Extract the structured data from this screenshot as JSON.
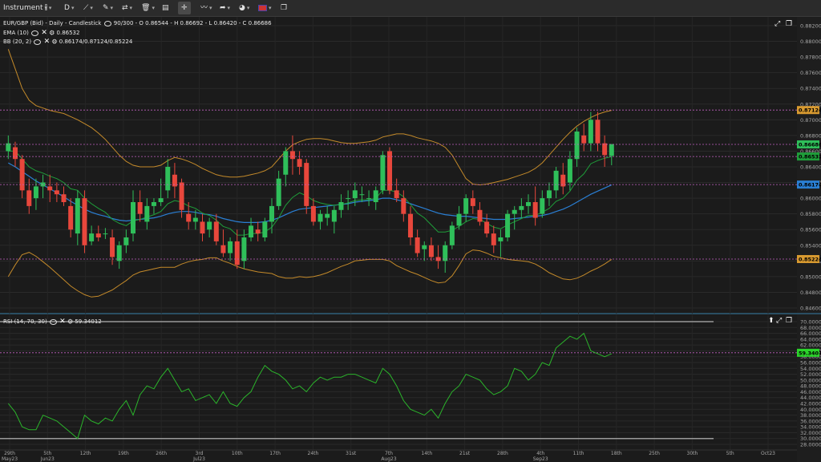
{
  "toolbar": {
    "instrument": "Instrument",
    "timeframe": "D"
  },
  "legend": {
    "main": "EUR/GBP (Bid) - Daily - Candlestick",
    "main_count": "90/300",
    "main_ohlc": "- O 0.86544 - H 0.86692 - L 0.86420 - C 0.86686",
    "ema_label": "EMA (10)",
    "ema_value": "0.86532",
    "bb_label": "BB (20, 2)",
    "bb_value": "0.86174/0.87124/0.85224",
    "rsi_label": "RSI (14, 70, 30)",
    "rsi_value": "59.34012"
  },
  "colors": {
    "up": "#2fbf5a",
    "down": "#e8473c",
    "ema": "#1f9e3a",
    "bb_mid": "#2a7fd4",
    "bb_band": "#c48a2a",
    "rsi": "#2bb52b",
    "hline": "#c060c0"
  },
  "price_axis": {
    "labels": [
      "0.88200",
      "0.88000",
      "0.87800",
      "0.87600",
      "0.87400",
      "0.87200",
      "0.87000",
      "0.86800",
      "0.86600",
      "0.86400",
      "0.86200",
      "0.86000",
      "0.85800",
      "0.85600",
      "0.85400",
      "0.85200",
      "0.85000",
      "0.84800",
      "0.84600"
    ],
    "markers": [
      {
        "value": 0.87124,
        "label": "0.87124",
        "color": "#d89a30"
      },
      {
        "value": 0.86686,
        "label": "0.86686",
        "color": "#2fbf5a"
      },
      {
        "value": 0.86532,
        "label": "0.86532",
        "color": "#1f9e3a"
      },
      {
        "value": 0.86174,
        "label": "0.86174",
        "color": "#2a7fd4"
      },
      {
        "value": 0.85224,
        "label": "0.85224",
        "color": "#d89a30"
      }
    ]
  },
  "rsi_axis": {
    "labels": [
      "70.00000",
      "68.00000",
      "66.00000",
      "64.00000",
      "62.00000",
      "60.00000",
      "58.00000",
      "56.00000",
      "54.00000",
      "52.00000",
      "50.00000",
      "48.00000",
      "46.00000",
      "44.00000",
      "42.00000",
      "40.00000",
      "38.00000",
      "36.00000",
      "34.00000",
      "32.00000",
      "30.00000",
      "28.00000"
    ],
    "marker": {
      "value": 59.34,
      "label": "59.34012"
    }
  },
  "x_axis": [
    {
      "day": "29th",
      "sub": "May23"
    },
    {
      "day": "5th",
      "sub": "Jun23"
    },
    {
      "day": "12th",
      "sub": ""
    },
    {
      "day": "19th",
      "sub": ""
    },
    {
      "day": "26th",
      "sub": ""
    },
    {
      "day": "3rd",
      "sub": "Jul23"
    },
    {
      "day": "10th",
      "sub": ""
    },
    {
      "day": "17th",
      "sub": ""
    },
    {
      "day": "24th",
      "sub": ""
    },
    {
      "day": "31st",
      "sub": ""
    },
    {
      "day": "7th",
      "sub": "Aug23"
    },
    {
      "day": "14th",
      "sub": ""
    },
    {
      "day": "21st",
      "sub": ""
    },
    {
      "day": "28th",
      "sub": ""
    },
    {
      "day": "4th",
      "sub": "Sep23"
    },
    {
      "day": "11th",
      "sub": ""
    },
    {
      "day": "18th",
      "sub": ""
    },
    {
      "day": "25th",
      "sub": ""
    },
    {
      "day": "30th",
      "sub": ""
    },
    {
      "day": "5th",
      "sub": ""
    },
    {
      "day": "Oct23",
      "sub": ""
    }
  ],
  "chart_data": {
    "type": "line",
    "candles": [
      [
        0.866,
        0.868,
        0.865,
        0.867
      ],
      [
        0.8665,
        0.8672,
        0.864,
        0.865
      ],
      [
        0.865,
        0.8655,
        0.86,
        0.861
      ],
      [
        0.861,
        0.8625,
        0.858,
        0.859
      ],
      [
        0.86,
        0.8625,
        0.8585,
        0.8615
      ],
      [
        0.8615,
        0.863,
        0.86,
        0.862
      ],
      [
        0.8615,
        0.863,
        0.8595,
        0.861
      ],
      [
        0.861,
        0.862,
        0.8595,
        0.8605
      ],
      [
        0.8605,
        0.8615,
        0.859,
        0.8595
      ],
      [
        0.859,
        0.86,
        0.855,
        0.856
      ],
      [
        0.8555,
        0.861,
        0.854,
        0.86
      ],
      [
        0.86,
        0.861,
        0.853,
        0.854
      ],
      [
        0.8545,
        0.8565,
        0.854,
        0.8555
      ],
      [
        0.8555,
        0.8565,
        0.8545,
        0.855
      ],
      [
        0.8555,
        0.8562,
        0.8548,
        0.8555
      ],
      [
        0.855,
        0.856,
        0.8515,
        0.8525
      ],
      [
        0.852,
        0.8545,
        0.851,
        0.854
      ],
      [
        0.854,
        0.856,
        0.853,
        0.855
      ],
      [
        0.8555,
        0.861,
        0.8545,
        0.8595
      ],
      [
        0.8595,
        0.861,
        0.857,
        0.858
      ],
      [
        0.857,
        0.86,
        0.856,
        0.859
      ],
      [
        0.859,
        0.86,
        0.858,
        0.8595
      ],
      [
        0.8595,
        0.8625,
        0.859,
        0.86
      ],
      [
        0.861,
        0.865,
        0.86,
        0.864
      ],
      [
        0.863,
        0.8645,
        0.86,
        0.8615
      ],
      [
        0.862,
        0.8625,
        0.8575,
        0.8585
      ],
      [
        0.858,
        0.8595,
        0.856,
        0.857
      ],
      [
        0.857,
        0.8585,
        0.856,
        0.8575
      ],
      [
        0.857,
        0.858,
        0.8545,
        0.8555
      ],
      [
        0.856,
        0.8575,
        0.855,
        0.857
      ],
      [
        0.857,
        0.858,
        0.854,
        0.8545
      ],
      [
        0.854,
        0.856,
        0.8525,
        0.853
      ],
      [
        0.853,
        0.855,
        0.852,
        0.8545
      ],
      [
        0.8545,
        0.856,
        0.851,
        0.8515
      ],
      [
        0.852,
        0.856,
        0.851,
        0.855
      ],
      [
        0.855,
        0.8575,
        0.8545,
        0.8565
      ],
      [
        0.856,
        0.857,
        0.8545,
        0.8555
      ],
      [
        0.855,
        0.8575,
        0.8545,
        0.857
      ],
      [
        0.857,
        0.86,
        0.8555,
        0.859
      ],
      [
        0.859,
        0.8635,
        0.8585,
        0.8625
      ],
      [
        0.863,
        0.8665,
        0.8615,
        0.866
      ],
      [
        0.866,
        0.868,
        0.863,
        0.865
      ],
      [
        0.865,
        0.866,
        0.863,
        0.864
      ],
      [
        0.8645,
        0.865,
        0.858,
        0.859
      ],
      [
        0.859,
        0.86,
        0.8565,
        0.857
      ],
      [
        0.857,
        0.8585,
        0.856,
        0.858
      ],
      [
        0.8575,
        0.859,
        0.8565,
        0.858
      ],
      [
        0.857,
        0.859,
        0.8555,
        0.8585
      ],
      [
        0.8585,
        0.8605,
        0.8575,
        0.8595
      ],
      [
        0.86,
        0.861,
        0.8585,
        0.86
      ],
      [
        0.86,
        0.862,
        0.859,
        0.861
      ],
      [
        0.8605,
        0.8615,
        0.8595,
        0.8605
      ],
      [
        0.86,
        0.861,
        0.859,
        0.86
      ],
      [
        0.8595,
        0.8615,
        0.8585,
        0.861
      ],
      [
        0.861,
        0.866,
        0.8605,
        0.8655
      ],
      [
        0.866,
        0.8665,
        0.8605,
        0.861
      ],
      [
        0.861,
        0.8625,
        0.8595,
        0.86
      ],
      [
        0.86,
        0.861,
        0.857,
        0.858
      ],
      [
        0.858,
        0.859,
        0.854,
        0.855
      ],
      [
        0.855,
        0.856,
        0.8525,
        0.853
      ],
      [
        0.8535,
        0.8545,
        0.852,
        0.854
      ],
      [
        0.854,
        0.855,
        0.852,
        0.8525
      ],
      [
        0.8525,
        0.854,
        0.851,
        0.852
      ],
      [
        0.852,
        0.8545,
        0.8505,
        0.854
      ],
      [
        0.854,
        0.857,
        0.8535,
        0.8565
      ],
      [
        0.8565,
        0.859,
        0.856,
        0.858
      ],
      [
        0.858,
        0.8605,
        0.857,
        0.86
      ],
      [
        0.86,
        0.861,
        0.858,
        0.859
      ],
      [
        0.8585,
        0.8595,
        0.8565,
        0.857
      ],
      [
        0.857,
        0.858,
        0.855,
        0.8555
      ],
      [
        0.8555,
        0.8565,
        0.853,
        0.854
      ],
      [
        0.8545,
        0.856,
        0.8525,
        0.855
      ],
      [
        0.855,
        0.8585,
        0.8545,
        0.858
      ],
      [
        0.858,
        0.859,
        0.856,
        0.8585
      ],
      [
        0.8585,
        0.86,
        0.8575,
        0.859
      ],
      [
        0.859,
        0.8605,
        0.858,
        0.8595
      ],
      [
        0.8595,
        0.8615,
        0.8565,
        0.8575
      ],
      [
        0.858,
        0.861,
        0.8575,
        0.86
      ],
      [
        0.86,
        0.862,
        0.859,
        0.861
      ],
      [
        0.861,
        0.864,
        0.86,
        0.8635
      ],
      [
        0.863,
        0.8645,
        0.8605,
        0.8615
      ],
      [
        0.862,
        0.866,
        0.861,
        0.865
      ],
      [
        0.865,
        0.869,
        0.864,
        0.8685
      ],
      [
        0.868,
        0.8695,
        0.866,
        0.867
      ],
      [
        0.867,
        0.871,
        0.866,
        0.87
      ],
      [
        0.87,
        0.871,
        0.866,
        0.867
      ],
      [
        0.867,
        0.868,
        0.864,
        0.8655
      ],
      [
        0.8654,
        0.8669,
        0.8642,
        0.8669
      ]
    ],
    "ema": [
      0.866,
      0.866,
      0.865,
      0.864,
      0.8635,
      0.8632,
      0.8628,
      0.8625,
      0.862,
      0.8612,
      0.861,
      0.86,
      0.8593,
      0.8587,
      0.8582,
      0.8573,
      0.8568,
      0.8565,
      0.8571,
      0.8573,
      0.8576,
      0.8579,
      0.8583,
      0.8593,
      0.8597,
      0.8595,
      0.859,
      0.8587,
      0.8581,
      0.8578,
      0.8572,
      0.8564,
      0.8561,
      0.8553,
      0.8553,
      0.8555,
      0.8555,
      0.8557,
      0.8563,
      0.8575,
      0.8591,
      0.8601,
      0.8607,
      0.8603,
      0.8597,
      0.8594,
      0.8592,
      0.8591,
      0.8592,
      0.8594,
      0.8597,
      0.8598,
      0.8598,
      0.86,
      0.861,
      0.861,
      0.8608,
      0.8602,
      0.8592,
      0.8581,
      0.8575,
      0.8566,
      0.8557,
      0.8557,
      0.8559,
      0.8564,
      0.857,
      0.8574,
      0.8573,
      0.8568,
      0.8563,
      0.8561,
      0.8566,
      0.857,
      0.8574,
      0.8578,
      0.8578,
      0.8582,
      0.8587,
      0.8596,
      0.86,
      0.8609,
      0.8623,
      0.8631,
      0.8644,
      0.8648,
      0.8651,
      0.8653
    ],
    "bb_mid": [
      0.8645,
      0.864,
      0.8634,
      0.8628,
      0.8622,
      0.8617,
      0.8612,
      0.8607,
      0.8602,
      0.8596,
      0.8591,
      0.8586,
      0.8582,
      0.8579,
      0.8577,
      0.8574,
      0.8572,
      0.8571,
      0.8572,
      0.8573,
      0.8574,
      0.8575,
      0.8577,
      0.858,
      0.8582,
      0.8583,
      0.8583,
      0.8582,
      0.858,
      0.8579,
      0.8577,
      0.8574,
      0.8572,
      0.857,
      0.8569,
      0.8569,
      0.8569,
      0.857,
      0.8572,
      0.8575,
      0.8579,
      0.8583,
      0.8586,
      0.8587,
      0.8588,
      0.8589,
      0.859,
      0.8591,
      0.8592,
      0.8593,
      0.8595,
      0.8596,
      0.8597,
      0.8598,
      0.86,
      0.86,
      0.8598,
      0.8596,
      0.8593,
      0.859,
      0.8587,
      0.8584,
      0.8581,
      0.8579,
      0.8578,
      0.8577,
      0.8577,
      0.8576,
      0.8575,
      0.8574,
      0.8573,
      0.8573,
      0.8573,
      0.8574,
      0.8575,
      0.8576,
      0.8577,
      0.8578,
      0.858,
      0.8583,
      0.8586,
      0.859,
      0.8595,
      0.86,
      0.8605,
      0.8609,
      0.8613,
      0.8617
    ],
    "bb_up": [
      0.879,
      0.8765,
      0.874,
      0.8725,
      0.8718,
      0.8715,
      0.8712,
      0.871,
      0.8708,
      0.8704,
      0.87,
      0.8695,
      0.869,
      0.8683,
      0.8675,
      0.8665,
      0.8655,
      0.8647,
      0.8642,
      0.864,
      0.864,
      0.864,
      0.8642,
      0.8648,
      0.8652,
      0.865,
      0.8647,
      0.8643,
      0.8638,
      0.8634,
      0.863,
      0.8628,
      0.8627,
      0.8627,
      0.8628,
      0.863,
      0.8632,
      0.8635,
      0.864,
      0.865,
      0.866,
      0.8668,
      0.8672,
      0.8675,
      0.8676,
      0.8676,
      0.8675,
      0.8673,
      0.8671,
      0.867,
      0.867,
      0.8671,
      0.8672,
      0.8674,
      0.8678,
      0.868,
      0.8682,
      0.8682,
      0.868,
      0.8677,
      0.8675,
      0.8673,
      0.867,
      0.8665,
      0.8655,
      0.864,
      0.8625,
      0.8618,
      0.8617,
      0.8618,
      0.862,
      0.8622,
      0.8624,
      0.8627,
      0.863,
      0.8633,
      0.8638,
      0.8645,
      0.8655,
      0.8665,
      0.8675,
      0.8684,
      0.8692,
      0.8698,
      0.8703,
      0.8707,
      0.871,
      0.8712
    ],
    "bb_low": [
      0.85,
      0.8515,
      0.8528,
      0.8531,
      0.8526,
      0.8519,
      0.8512,
      0.8504,
      0.8496,
      0.8488,
      0.8482,
      0.8477,
      0.8474,
      0.8475,
      0.8479,
      0.8483,
      0.8489,
      0.8495,
      0.8502,
      0.8506,
      0.8508,
      0.851,
      0.8512,
      0.8512,
      0.8512,
      0.8516,
      0.8519,
      0.8521,
      0.8522,
      0.8524,
      0.8524,
      0.852,
      0.8517,
      0.8513,
      0.851,
      0.8508,
      0.8506,
      0.8505,
      0.8504,
      0.85,
      0.8498,
      0.8498,
      0.85,
      0.8499,
      0.85,
      0.8502,
      0.8505,
      0.8509,
      0.8513,
      0.8516,
      0.852,
      0.8521,
      0.8522,
      0.8522,
      0.8522,
      0.852,
      0.8514,
      0.851,
      0.8506,
      0.8503,
      0.8499,
      0.8495,
      0.8492,
      0.8493,
      0.8501,
      0.8514,
      0.8529,
      0.8534,
      0.8533,
      0.853,
      0.8526,
      0.8524,
      0.8522,
      0.8521,
      0.852,
      0.8519,
      0.8516,
      0.8511,
      0.8505,
      0.8501,
      0.8497,
      0.8496,
      0.8498,
      0.8502,
      0.8507,
      0.8511,
      0.8516,
      0.8522
    ],
    "rsi": [
      42,
      39,
      34,
      33,
      33,
      38,
      37,
      36,
      34,
      32,
      30,
      38,
      36,
      35,
      37,
      36,
      40,
      43,
      38,
      45,
      48,
      47,
      51,
      54,
      50,
      46,
      47,
      43,
      44,
      45,
      42,
      46,
      42,
      41,
      44,
      46,
      51,
      55,
      53,
      52,
      50,
      47,
      48,
      46,
      49,
      51,
      50,
      51,
      51,
      52,
      52,
      51,
      50,
      49,
      54,
      52,
      48,
      43,
      40,
      39,
      38,
      40,
      37,
      42,
      46,
      48,
      52,
      51,
      50,
      47,
      45,
      46,
      48,
      54,
      53,
      50,
      52,
      56,
      55,
      61,
      63,
      65,
      64,
      66,
      60,
      59,
      58,
      59
    ]
  }
}
